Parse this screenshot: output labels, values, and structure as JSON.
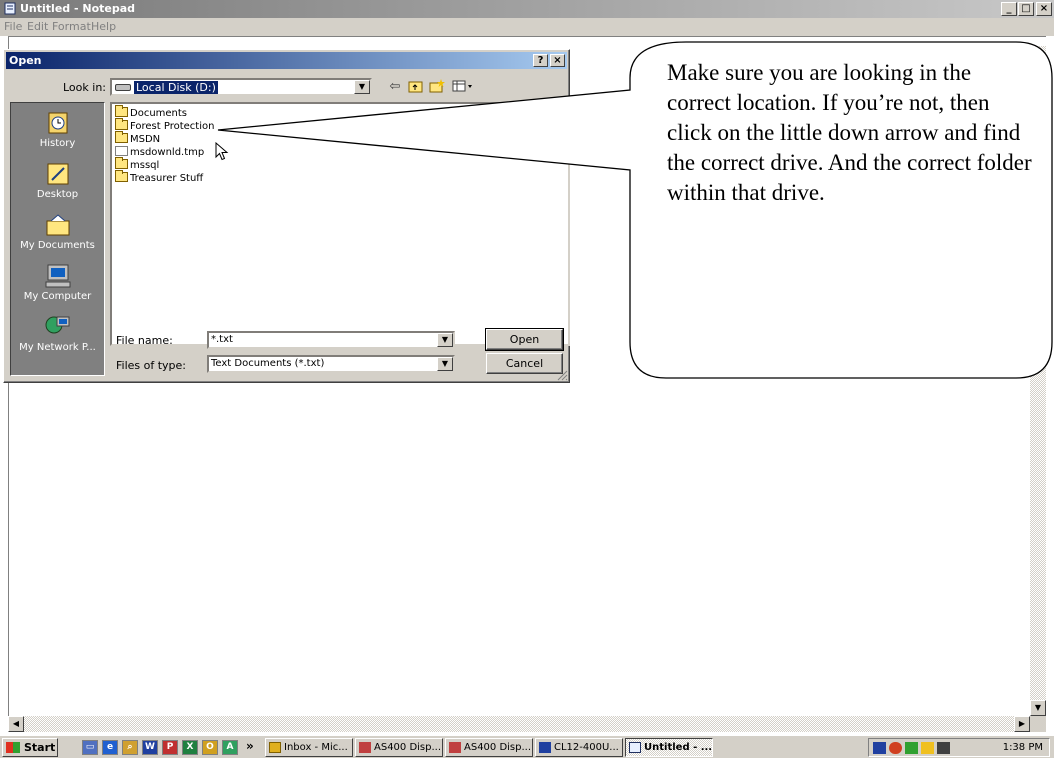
{
  "notepad": {
    "title": "Untitled - Notepad",
    "menu": [
      "File",
      "Edit",
      "Format",
      "Help"
    ],
    "caption_buttons": [
      "_",
      "□",
      "×"
    ]
  },
  "dialog": {
    "title": "Open",
    "help_btn": "?",
    "close_btn": "×",
    "look_in_label": "Look in:",
    "look_in_value": "Local Disk (D:)",
    "toolbar_icons": [
      "back-arrow-icon",
      "up-folder-icon",
      "new-folder-icon",
      "view-menu-icon"
    ],
    "places": [
      {
        "label": "History"
      },
      {
        "label": "Desktop"
      },
      {
        "label": "My Documents"
      },
      {
        "label": "My Computer"
      },
      {
        "label": "My Network P..."
      }
    ],
    "files": [
      {
        "name": "Documents",
        "type": "folder"
      },
      {
        "name": "Forest Protection",
        "type": "folder"
      },
      {
        "name": "MSDN",
        "type": "folder"
      },
      {
        "name": "msdownld.tmp",
        "type": "file"
      },
      {
        "name": "mssql",
        "type": "folder"
      },
      {
        "name": "Treasurer Stuff",
        "type": "folder"
      }
    ],
    "file_name_label": "File name:",
    "file_name_value": "*.txt",
    "files_of_type_label": "Files of type:",
    "files_of_type_value": "Text Documents (*.txt)",
    "open_button": "Open",
    "cancel_button": "Cancel"
  },
  "callout": {
    "text": "Make sure you are looking in the correct location.  If you’re not, then click on the little down arrow and find the correct drive.  And the correct folder within that drive."
  },
  "taskbar": {
    "start_label": "Start",
    "quick_launch_more": "»",
    "tasks": [
      {
        "label": "Inbox - Mic..."
      },
      {
        "label": "AS400 Disp..."
      },
      {
        "label": "AS400 Disp..."
      },
      {
        "label": "CL12-400U..."
      },
      {
        "label": "Untitled - ..."
      }
    ],
    "clock": "1:38 PM"
  },
  "colors": {
    "dialog_title": "#0a246a",
    "face": "#d4d0c8",
    "selection": "#0a246a"
  }
}
